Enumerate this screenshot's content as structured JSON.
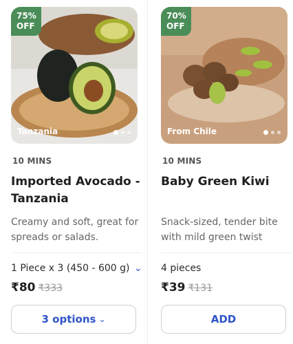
{
  "products": [
    {
      "discount": "75% OFF",
      "discount_top": "75%",
      "discount_bottom": "OFF",
      "origin": "Tanzania",
      "eta": "10 MINS",
      "title": "Imported Avocado - Tanzania",
      "description": "Creamy and soft, great for spreads or salads.",
      "variant": "1 Piece x 3 (450 - 600 g)",
      "price": "₹80",
      "mrp": "₹333",
      "button_label": "3 options"
    },
    {
      "discount": "70% OFF",
      "discount_top": "70%",
      "discount_bottom": "OFF",
      "origin": "From Chile",
      "eta": "10 MINS",
      "title": "Baby Green Kiwi",
      "description": "Snack-sized, tender bite with mild green twist",
      "variant": "4 pieces",
      "price": "₹39",
      "mrp": "₹131",
      "button_label": "ADD"
    }
  ],
  "colors": {
    "badge": "#4a8d58",
    "accent": "#2e55c8"
  },
  "icons": {
    "variant_chevron": "chevron-down-icon",
    "options_chevron": "chevron-down-icon"
  }
}
